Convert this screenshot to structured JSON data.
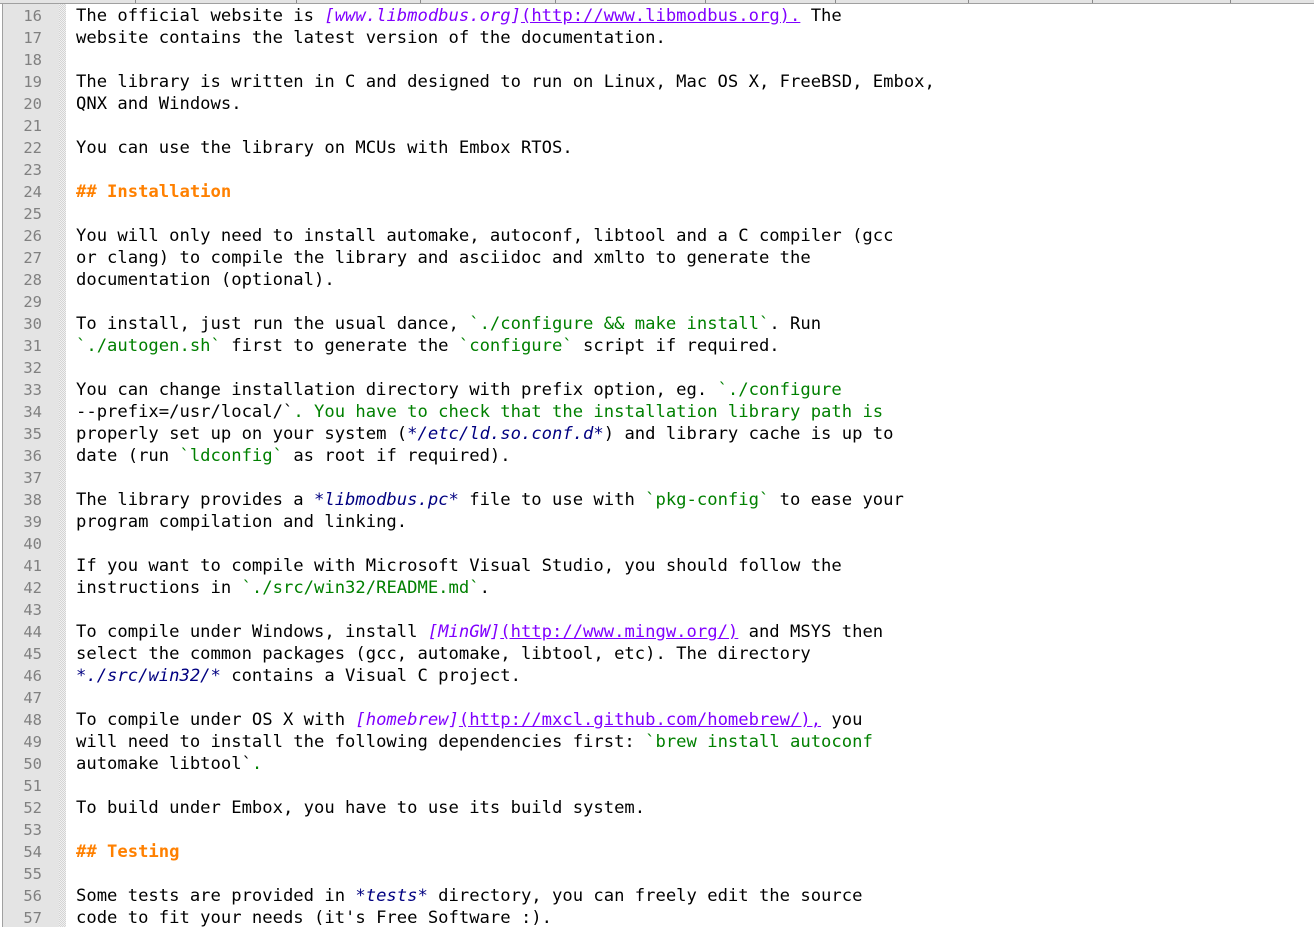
{
  "editor": {
    "language": "Markdown",
    "colors": {
      "text": "#000000",
      "link_text": "#8000ff",
      "url": "#8000ff",
      "code_span": "#008000",
      "emphasis": "#000080",
      "header": "#ff8000",
      "line_number": "#808080",
      "gutter": "#e4e4e4"
    },
    "lines": [
      {
        "n": "16",
        "segments": [
          {
            "t": "The official website is ",
            "k": "plain"
          },
          {
            "t": "[www.libmodbus.org]",
            "k": "link"
          },
          {
            "t": "(http://www.libmodbus.org).",
            "k": "url"
          },
          {
            "t": " The",
            "k": "plain"
          }
        ]
      },
      {
        "n": "17",
        "segments": [
          {
            "t": "website contains the latest version of the documentation.",
            "k": "plain"
          }
        ]
      },
      {
        "n": "18",
        "segments": []
      },
      {
        "n": "19",
        "segments": [
          {
            "t": "The library is written in C and designed to run on Linux, Mac OS X, FreeBSD, Embox,",
            "k": "plain"
          }
        ]
      },
      {
        "n": "20",
        "segments": [
          {
            "t": "QNX and Windows.",
            "k": "plain"
          }
        ]
      },
      {
        "n": "21",
        "segments": []
      },
      {
        "n": "22",
        "segments": [
          {
            "t": "You can use the library on MCUs with Embox RTOS.",
            "k": "plain"
          }
        ]
      },
      {
        "n": "23",
        "segments": []
      },
      {
        "n": "24",
        "segments": [
          {
            "t": "## Installation",
            "k": "header"
          }
        ]
      },
      {
        "n": "25",
        "segments": []
      },
      {
        "n": "26",
        "segments": [
          {
            "t": "You will only need to install automake, autoconf, libtool and a C compiler (gcc",
            "k": "plain"
          }
        ]
      },
      {
        "n": "27",
        "segments": [
          {
            "t": "or clang) to compile the library and asciidoc and xmlto to generate the",
            "k": "plain"
          }
        ]
      },
      {
        "n": "28",
        "segments": [
          {
            "t": "documentation (optional).",
            "k": "plain"
          }
        ]
      },
      {
        "n": "29",
        "segments": []
      },
      {
        "n": "30",
        "segments": [
          {
            "t": "To install, just run the usual dance, ",
            "k": "plain"
          },
          {
            "t": "`./configure && make install`",
            "k": "code"
          },
          {
            "t": ". Run",
            "k": "plain"
          }
        ]
      },
      {
        "n": "31",
        "segments": [
          {
            "t": "`./autogen.sh`",
            "k": "code"
          },
          {
            "t": " first to generate the ",
            "k": "plain"
          },
          {
            "t": "`configure`",
            "k": "code"
          },
          {
            "t": " script if required.",
            "k": "plain"
          }
        ]
      },
      {
        "n": "32",
        "segments": []
      },
      {
        "n": "33",
        "segments": [
          {
            "t": "You can change installation directory with prefix option, eg. ",
            "k": "plain"
          },
          {
            "t": "`./configure",
            "k": "code"
          }
        ]
      },
      {
        "n": "34",
        "segments": [
          {
            "t": "--prefix=/usr/local/`",
            "k": "plain"
          },
          {
            "t": ". You have to check that the installation library path is",
            "k": "code"
          }
        ]
      },
      {
        "n": "35",
        "segments": [
          {
            "t": "properly set up on your system (",
            "k": "plain"
          },
          {
            "t": "*/etc/ld.so.conf.d*",
            "k": "em"
          },
          {
            "t": ") and library cache is up to",
            "k": "plain"
          }
        ]
      },
      {
        "n": "36",
        "segments": [
          {
            "t": "date (run ",
            "k": "plain"
          },
          {
            "t": "`ldconfig`",
            "k": "code"
          },
          {
            "t": " as root if required).",
            "k": "plain"
          }
        ]
      },
      {
        "n": "37",
        "segments": []
      },
      {
        "n": "38",
        "segments": [
          {
            "t": "The library provides a ",
            "k": "plain"
          },
          {
            "t": "*libmodbus.pc*",
            "k": "em"
          },
          {
            "t": " file to use with ",
            "k": "plain"
          },
          {
            "t": "`pkg-config`",
            "k": "code"
          },
          {
            "t": " to ease your",
            "k": "plain"
          }
        ]
      },
      {
        "n": "39",
        "segments": [
          {
            "t": "program compilation and linking.",
            "k": "plain"
          }
        ]
      },
      {
        "n": "40",
        "segments": []
      },
      {
        "n": "41",
        "segments": [
          {
            "t": "If you want to compile with Microsoft Visual Studio, you should follow the",
            "k": "plain"
          }
        ]
      },
      {
        "n": "42",
        "segments": [
          {
            "t": "instructions in ",
            "k": "plain"
          },
          {
            "t": "`./src/win32/README.md`",
            "k": "code"
          },
          {
            "t": ".",
            "k": "plain"
          }
        ]
      },
      {
        "n": "43",
        "segments": []
      },
      {
        "n": "44",
        "segments": [
          {
            "t": "To compile under Windows, install ",
            "k": "plain"
          },
          {
            "t": "[MinGW]",
            "k": "link"
          },
          {
            "t": "(http://www.mingw.org/)",
            "k": "url"
          },
          {
            "t": " and MSYS then",
            "k": "plain"
          }
        ]
      },
      {
        "n": "45",
        "segments": [
          {
            "t": "select the common packages (gcc, automake, libtool, etc). The directory",
            "k": "plain"
          }
        ]
      },
      {
        "n": "46",
        "segments": [
          {
            "t": "*./src/win32/*",
            "k": "em"
          },
          {
            "t": " contains a Visual C project.",
            "k": "plain"
          }
        ]
      },
      {
        "n": "47",
        "segments": []
      },
      {
        "n": "48",
        "segments": [
          {
            "t": "To compile under OS X with ",
            "k": "plain"
          },
          {
            "t": "[homebrew]",
            "k": "link"
          },
          {
            "t": "(http://mxcl.github.com/homebrew/),",
            "k": "url"
          },
          {
            "t": " you",
            "k": "plain"
          }
        ]
      },
      {
        "n": "49",
        "segments": [
          {
            "t": "will need to install the following dependencies first: ",
            "k": "plain"
          },
          {
            "t": "`brew install autoconf",
            "k": "code"
          }
        ]
      },
      {
        "n": "50",
        "segments": [
          {
            "t": "automake libtool`",
            "k": "plain"
          },
          {
            "t": ".",
            "k": "code"
          }
        ]
      },
      {
        "n": "51",
        "segments": []
      },
      {
        "n": "52",
        "segments": [
          {
            "t": "To build under Embox, you have to use its build system.",
            "k": "plain"
          }
        ]
      },
      {
        "n": "53",
        "segments": []
      },
      {
        "n": "54",
        "segments": [
          {
            "t": "## Testing",
            "k": "header"
          }
        ]
      },
      {
        "n": "55",
        "segments": []
      },
      {
        "n": "56",
        "segments": [
          {
            "t": "Some tests are provided in ",
            "k": "plain"
          },
          {
            "t": "*tests*",
            "k": "em"
          },
          {
            "t": " directory, you can freely edit the source",
            "k": "plain"
          }
        ]
      },
      {
        "n": "57",
        "segments": [
          {
            "t": "code to fit your needs (it's Free Software :).",
            "k": "plain"
          }
        ]
      }
    ]
  }
}
